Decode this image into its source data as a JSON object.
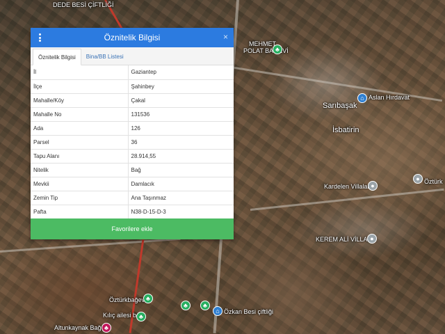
{
  "dialog": {
    "title": "Öznitelik Bilgisi",
    "close_glyph": "×",
    "menu_icon": "vertical-ellipsis-icon",
    "tabs": [
      {
        "label": "Öznitelik Bilgisi",
        "active": true
      },
      {
        "label": "Bina/BB Listesi",
        "active": false
      }
    ],
    "rows": [
      {
        "key": "İl",
        "value": "Gaziantep"
      },
      {
        "key": "İlçe",
        "value": "Şahinbey"
      },
      {
        "key": "Mahalle/Köy",
        "value": "Çakal"
      },
      {
        "key": "Mahalle No",
        "value": "131536"
      },
      {
        "key": "Ada",
        "value": "126"
      },
      {
        "key": "Parsel",
        "value": "36"
      },
      {
        "key": "Tapu Alanı",
        "value": "28.914,55"
      },
      {
        "key": "Nitelik",
        "value": "Bağ"
      },
      {
        "key": "Mevkii",
        "value": "Damlacık"
      },
      {
        "key": "Zemin Tip",
        "value": "Ana Taşınmaz"
      },
      {
        "key": "Pafta",
        "value": "N38-D-15-D-3"
      }
    ],
    "favorite_button": "Favorilere ekle",
    "colors": {
      "header": "#2c7be0",
      "button": "#4cbb63"
    }
  },
  "map": {
    "labels": {
      "top_left": "DEDE BESİ ÇİFTLİĞİ",
      "mehmet": "MEHMET",
      "polat": "POLAT BAĞEVİ",
      "aslan": "Aslan Hırdavat",
      "saribasak": "Sarıbaşak",
      "isbatirin": "İsbatirin",
      "kardelen": "Kardelen Villaları",
      "ozturk_right": "Öztürk",
      "kerem": "KEREM ALİ VİLLAGE",
      "ozturk_bagevi": "Öztürkbağevi",
      "ozkan": "Özkan Besi çiftliği",
      "kilic": "Kılıç ailesi bağ",
      "altunkaynak": "Altunkaynak Bağ E"
    },
    "pin_icons": {
      "park": "tree-pin-icon",
      "shop": "shop-pin-icon",
      "lodging": "lodging-pin-icon"
    }
  }
}
